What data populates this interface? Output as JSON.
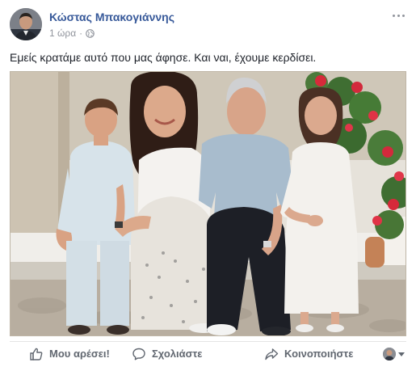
{
  "post": {
    "author": "Κώστας Μπακογιάννης",
    "time": "1 ώρα",
    "separator": "·",
    "audience_icon": "globe-icon",
    "text": "Εμείς κρατάμε αυτό που μας άφησε. Και ναι, έχουμε κερδίσει."
  },
  "actions": {
    "like_label": "Μου αρέσει!",
    "comment_label": "Σχολιάστε",
    "share_label": "Κοινοποιήστε"
  },
  "colors": {
    "author_link": "#365899",
    "meta_text": "#90949c",
    "action_text": "#616770",
    "body_text": "#1d2129"
  }
}
